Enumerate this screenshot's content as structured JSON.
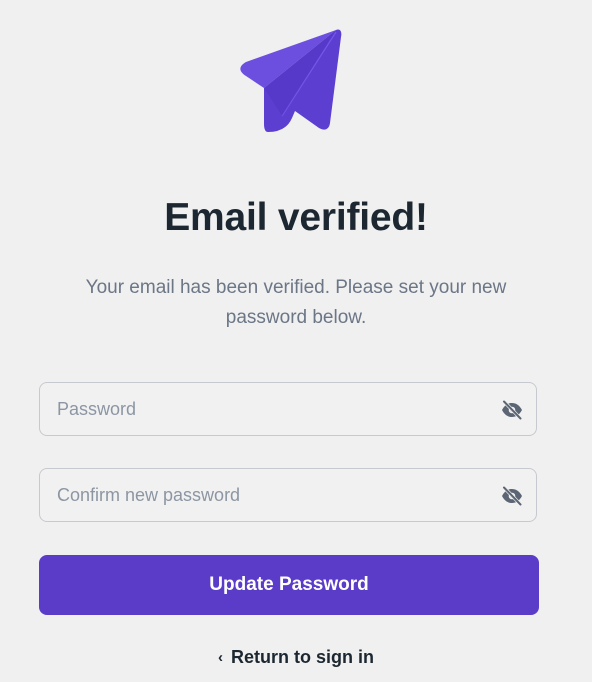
{
  "logo": {
    "icon": "paper-plane-icon",
    "color": "#5b3cc8"
  },
  "header": {
    "title": "Email verified!",
    "subtitle": "Your email has been verified. Please set your new password below."
  },
  "form": {
    "password": {
      "placeholder": "Password",
      "value": "",
      "toggle_icon": "eye-off-icon"
    },
    "confirm_password": {
      "placeholder": "Confirm new password",
      "value": "",
      "toggle_icon": "eye-off-icon"
    },
    "submit_label": "Update Password"
  },
  "footer": {
    "back_icon": "chevron-left-icon",
    "back_label": "Return to sign in"
  },
  "colors": {
    "background": "#f0f0f0",
    "primary": "#5b3cc8",
    "title": "#1d2731",
    "muted": "#6b7686"
  }
}
